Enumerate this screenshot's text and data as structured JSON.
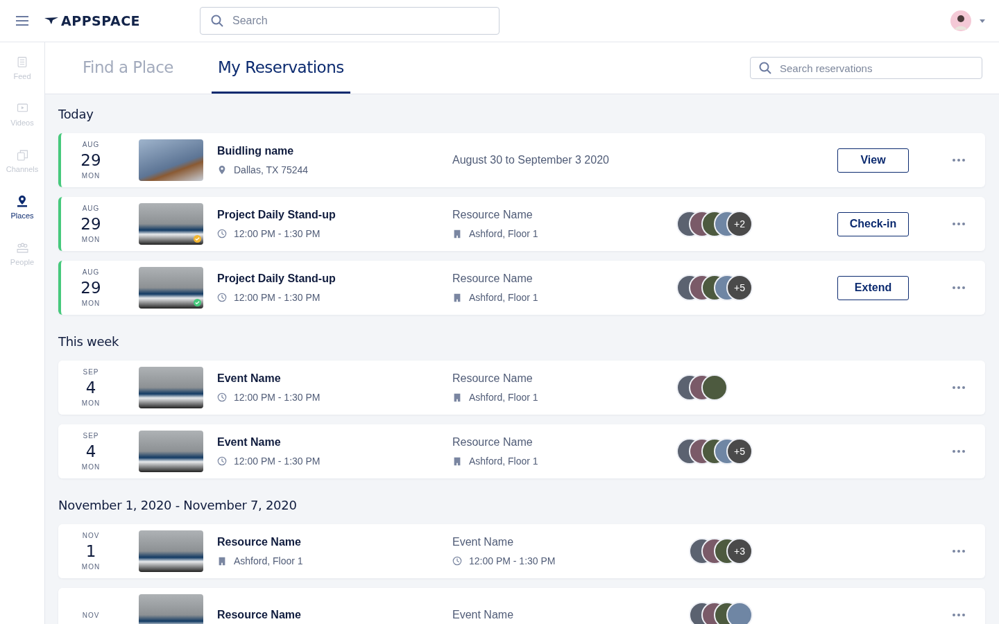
{
  "header": {
    "logo": "APPSPACE",
    "search": {
      "placeholder": "Search"
    }
  },
  "sidebar": {
    "items": [
      {
        "label": "Feed",
        "selected": false
      },
      {
        "label": "Videos",
        "selected": false
      },
      {
        "label": "Channels",
        "selected": false
      },
      {
        "label": "Places",
        "selected": true
      },
      {
        "label": "People",
        "selected": false
      }
    ]
  },
  "tabs": [
    {
      "label": "Find a Place",
      "selected": false
    },
    {
      "label": "My Reservations",
      "selected": true
    }
  ],
  "reservation_search": {
    "placeholder": "Search reservations"
  },
  "sections": [
    {
      "title": "Today",
      "cards": [
        {
          "kind": "building",
          "active": true,
          "month": "AUG",
          "day": "29",
          "weekday": "MON",
          "title": "Buidling name",
          "detail": "Dallas, TX 75244",
          "middle": "August 30 to September 3 2020",
          "action": "View"
        },
        {
          "kind": "event",
          "active": true,
          "month": "AUG",
          "day": "29",
          "weekday": "MON",
          "badge": {
            "color": "#f2b632"
          },
          "title": "Project Daily Stand-up",
          "detail": "12:00 PM - 1:30 PM",
          "middle": "Resource Name",
          "middle_sub": "Ashford, Floor 1",
          "avatars": [
            {
              "kind": "photo"
            },
            {
              "kind": "photo"
            },
            {
              "kind": "photo"
            },
            {
              "kind": "photo"
            },
            {
              "kind": "more",
              "label": "+2"
            }
          ],
          "action": "Check-in"
        },
        {
          "kind": "event",
          "active": true,
          "month": "AUG",
          "day": "29",
          "weekday": "MON",
          "badge": {
            "color": "#46c97c"
          },
          "title": "Project Daily Stand-up",
          "detail": "12:00 PM - 1:30 PM",
          "middle": "Resource Name",
          "middle_sub": "Ashford, Floor 1",
          "avatars": [
            {
              "kind": "photo"
            },
            {
              "kind": "photo"
            },
            {
              "kind": "photo"
            },
            {
              "kind": "photo"
            },
            {
              "kind": "more",
              "label": "+5"
            }
          ],
          "action": "Extend"
        }
      ]
    },
    {
      "title": "This week",
      "cards": [
        {
          "kind": "event",
          "active": false,
          "month": "SEP",
          "day": "4",
          "weekday": "MON",
          "title": "Event Name",
          "detail": "12:00 PM - 1:30 PM",
          "middle": "Resource Name",
          "middle_sub": "Ashford, Floor 1",
          "avatars": [
            {
              "kind": "photo"
            },
            {
              "kind": "photo"
            },
            {
              "kind": "photo"
            }
          ]
        },
        {
          "kind": "event",
          "active": false,
          "month": "SEP",
          "day": "4",
          "weekday": "MON",
          "title": "Event Name",
          "detail": "12:00 PM - 1:30 PM",
          "middle": "Resource Name",
          "middle_sub": "Ashford, Floor 1",
          "avatars": [
            {
              "kind": "photo"
            },
            {
              "kind": "photo"
            },
            {
              "kind": "photo"
            },
            {
              "kind": "photo"
            },
            {
              "kind": "more",
              "label": "+5"
            }
          ]
        }
      ]
    },
    {
      "title": "November 1, 2020 - November 7, 2020",
      "cards": [
        {
          "kind": "resource",
          "active": false,
          "month": "NOV",
          "day": "1",
          "weekday": "MON",
          "title": "Resource Name",
          "detail": "Ashford, Floor 1",
          "middle": "Event Name",
          "middle_sub": "12:00 PM - 1:30 PM",
          "avatars": [
            {
              "kind": "photo"
            },
            {
              "kind": "photo"
            },
            {
              "kind": "photo"
            },
            {
              "kind": "more",
              "label": "+3"
            }
          ]
        },
        {
          "kind": "resource",
          "active": false,
          "month": "NOV",
          "title": "Resource Name",
          "middle": "Event Name",
          "avatars": [
            {
              "kind": "photo"
            },
            {
              "kind": "photo"
            },
            {
              "kind": "photo"
            },
            {
              "kind": "photo"
            }
          ]
        }
      ]
    }
  ]
}
